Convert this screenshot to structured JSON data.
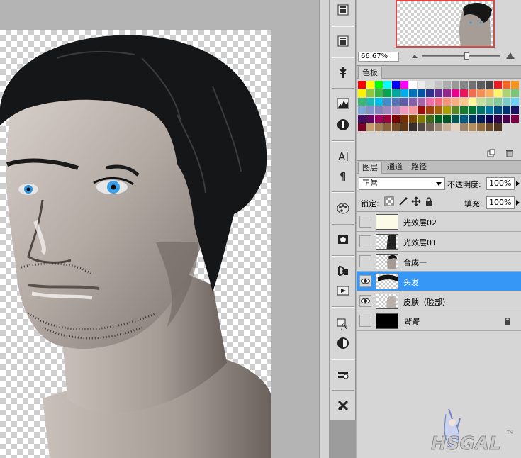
{
  "navigator": {
    "zoom": "66.67%"
  },
  "swatches": {
    "tab_label": "色板",
    "colors": [
      "#ff0000",
      "#ffff00",
      "#00ff00",
      "#00ffff",
      "#0000ff",
      "#ff00ff",
      "#ffffff",
      "#ebebeb",
      "#d6d6d6",
      "#c2c2c2",
      "#adadad",
      "#999999",
      "#858585",
      "#707070",
      "#5c5c5c",
      "#474747",
      "#ed1c24",
      "#f26522",
      "#f7941d",
      "#fff200",
      "#8dc63f",
      "#39b54a",
      "#00a651",
      "#00a99d",
      "#00aeef",
      "#0072bc",
      "#0054a6",
      "#2e3192",
      "#662d91",
      "#92278f",
      "#ec008c",
      "#ed145b",
      "#f26c4f",
      "#f68e56",
      "#fbaf5d",
      "#fff568",
      "#acd373",
      "#7cc576",
      "#3bb878",
      "#1abbb4",
      "#00bff3",
      "#438ccb",
      "#5674b9",
      "#605ca8",
      "#8560a8",
      "#a864a8",
      "#f06eaa",
      "#f26d7d",
      "#f7977a",
      "#f9ad81",
      "#fdc68a",
      "#fff79a",
      "#c4df9b",
      "#a3d39c",
      "#82ca9c",
      "#7accc8",
      "#6dcff6",
      "#7da7d9",
      "#8393ca",
      "#8781bd",
      "#a187be",
      "#bd8cbf",
      "#f49ac1",
      "#f5989d",
      "#9e0b0f",
      "#a0410d",
      "#a3620a",
      "#aba000",
      "#598527",
      "#197b30",
      "#007236",
      "#00746b",
      "#0076a3",
      "#004a80",
      "#003471",
      "#1b1464",
      "#440e62",
      "#630460",
      "#9e005d",
      "#9e0039",
      "#790000",
      "#7b2e00",
      "#7d4900",
      "#827b00",
      "#406618",
      "#005e20",
      "#005826",
      "#005952",
      "#005b7f",
      "#003663",
      "#002157",
      "#0d004c",
      "#32004b",
      "#4b0049",
      "#7b0046",
      "#7a0026",
      "#c69c6d",
      "#a67c52",
      "#8c6239",
      "#754c24",
      "#603913",
      "#362f2d",
      "#534741",
      "#736357",
      "#998675",
      "#c7b299",
      "#e3d3c0",
      "#a0866a",
      "#b68f5e",
      "#956c3e",
      "#6b4b29",
      "#4e3520"
    ]
  },
  "layers": {
    "tabs": [
      "图层",
      "通道",
      "路径"
    ],
    "blend_mode": "正常",
    "opacity_label": "不透明度:",
    "opacity": "100%",
    "lock_label": "锁定:",
    "fill_label": "填充:",
    "fill": "100%",
    "items": [
      {
        "name": "光效层02",
        "visible": false,
        "selected": false
      },
      {
        "name": "光效层01",
        "visible": false,
        "selected": false
      },
      {
        "name": "合成一",
        "visible": false,
        "selected": false
      },
      {
        "name": "头发",
        "visible": true,
        "selected": true
      },
      {
        "name": "皮肤（脸部）",
        "visible": true,
        "selected": false
      },
      {
        "name": "背景",
        "visible": false,
        "selected": false,
        "locked": true
      }
    ]
  },
  "watermark": {
    "text": "HSGAL",
    "tm": "TM"
  },
  "colors": {
    "selection": "#3797f6",
    "panel_bg": "#d6d6d6",
    "nav_frame": "#d54b4b"
  }
}
